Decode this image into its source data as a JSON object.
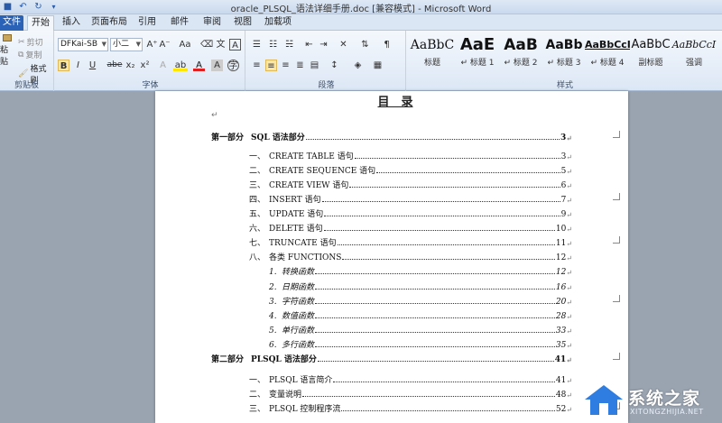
{
  "window": {
    "title": "oracle_PLSQL_语法详细手册.doc [兼容模式] - Microsoft Word"
  },
  "quick_access": [
    {
      "icon": "save-icon",
      "glyph": "💾"
    },
    {
      "icon": "undo-icon",
      "glyph": "↶"
    },
    {
      "icon": "redo-icon",
      "glyph": "↻"
    }
  ],
  "tabs": [
    {
      "label": "文件",
      "name": "tab-file"
    },
    {
      "label": "开始",
      "name": "tab-home"
    },
    {
      "label": "插入",
      "name": "tab-insert"
    },
    {
      "label": "页面布局",
      "name": "tab-page-layout"
    },
    {
      "label": "引用",
      "name": "tab-references"
    },
    {
      "label": "邮件",
      "name": "tab-mailings"
    },
    {
      "label": "审阅",
      "name": "tab-review"
    },
    {
      "label": "视图",
      "name": "tab-view"
    },
    {
      "label": "加载项",
      "name": "tab-addins"
    }
  ],
  "ribbon": {
    "clipboard": {
      "label": "剪贴板",
      "paste": "粘贴",
      "cut": "剪切",
      "copy": "复制",
      "format_painter": "格式刷"
    },
    "font": {
      "label": "字体",
      "font_name": "DFKai-SB",
      "font_size": "小二",
      "aa_label": "Aa",
      "bold": "B",
      "italic": "I",
      "underline": "U",
      "strikethrough": "abe",
      "subscript": "x₂",
      "superscript": "x²",
      "grow": "A⁺",
      "shrink": "A⁻",
      "clear": "A",
      "font_color": "A",
      "highlight": "ab",
      "char_border": "A",
      "phonetic": "wén",
      "enclose": "字"
    },
    "paragraph": {
      "label": "段落"
    },
    "styles": {
      "label": "样式",
      "items": [
        {
          "sample": "AaBbC",
          "name": "标题"
        },
        {
          "sample": "AaE",
          "name": "↵ 标题 1"
        },
        {
          "sample": "AaB",
          "name": "↵ 标题 2"
        },
        {
          "sample": "AaBb",
          "name": "↵ 标题 3"
        },
        {
          "sample": "AaBbCcI",
          "name": "↵ 标题 4"
        },
        {
          "sample": "AaBbC",
          "name": "副标题"
        },
        {
          "sample": "AaBbCcI",
          "name": "强调"
        }
      ]
    }
  },
  "document": {
    "toc_title": "目　录",
    "para_mark": "↵",
    "entries": [
      {
        "kind": "part",
        "num": "第一部分",
        "text": "SQL 语法部分",
        "page": "3"
      },
      {
        "kind": "chap",
        "num": "一、",
        "text": "CREATE TABLE 语句",
        "page": "3"
      },
      {
        "kind": "chap",
        "num": "二、",
        "text": "CREATE SEQUENCE 语句",
        "page": "5"
      },
      {
        "kind": "chap",
        "num": "三、",
        "text": "CREATE VIEW 语句",
        "page": "6"
      },
      {
        "kind": "chap",
        "num": "四、",
        "text": "INSERT 语句",
        "page": "7"
      },
      {
        "kind": "chap",
        "num": "五、",
        "text": "UPDATE 语句",
        "page": "9"
      },
      {
        "kind": "chap",
        "num": "六、",
        "text": "DELETE 语句",
        "page": "10"
      },
      {
        "kind": "chap",
        "num": "七、",
        "text": "TRUNCATE 语句",
        "page": "11"
      },
      {
        "kind": "chap",
        "num": "八、",
        "text": "各类 FUNCTIONS",
        "page": "12"
      },
      {
        "kind": "sub",
        "num": "1.",
        "text": "转换函数",
        "page": "12"
      },
      {
        "kind": "sub",
        "num": "2.",
        "text": "日期函数",
        "page": "16"
      },
      {
        "kind": "sub",
        "num": "3.",
        "text": "字符函数",
        "page": "20"
      },
      {
        "kind": "sub",
        "num": "4.",
        "text": "数值函数",
        "page": "28"
      },
      {
        "kind": "sub",
        "num": "5.",
        "text": "单行函数",
        "page": "33"
      },
      {
        "kind": "sub",
        "num": "6.",
        "text": "多行函数",
        "page": "35"
      },
      {
        "kind": "part",
        "num": "第二部分",
        "text": "PLSQL 语法部分",
        "page": "41"
      },
      {
        "kind": "chap",
        "num": "一、",
        "text": "PLSQL 语言简介",
        "page": "41"
      },
      {
        "kind": "chap",
        "num": "二、",
        "text": "变量说明",
        "page": "48"
      },
      {
        "kind": "chap",
        "num": "三、",
        "text": "PLSQL 控制程序流",
        "page": "52"
      }
    ]
  },
  "watermark": {
    "text": "系统之家",
    "sub": "XITONGZHIJIA.NET"
  }
}
